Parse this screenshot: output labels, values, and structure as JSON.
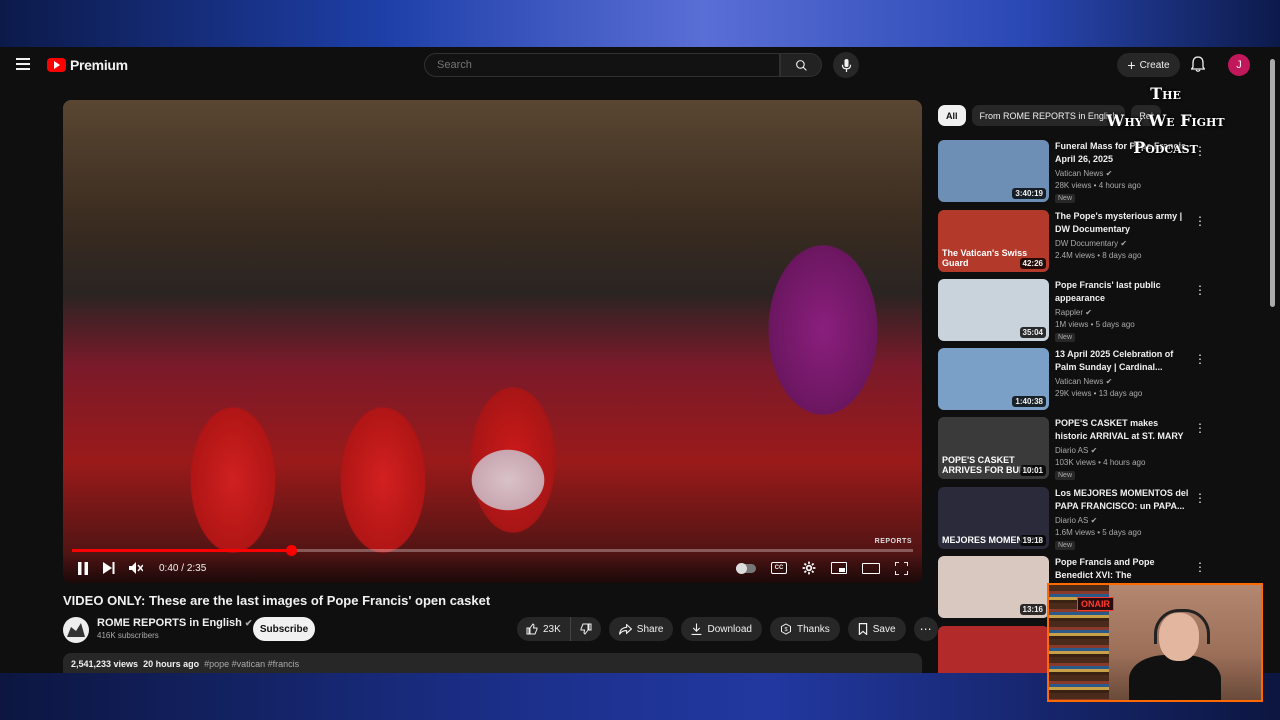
{
  "header": {
    "logo_text": "Premium",
    "search_placeholder": "Search",
    "create_label": "Create",
    "avatar_letter": "J"
  },
  "player": {
    "time_current": "0:40",
    "time_total": "2:35",
    "progress": 0.26,
    "watermark": "REPORTS"
  },
  "video": {
    "title": "VIDEO ONLY: These are the last images of Pope Francis' open casket",
    "channel": "ROME REPORTS in English",
    "subscribers": "416K subscribers",
    "subscribe_label": "Subscribe",
    "likes": "23K",
    "share_label": "Share",
    "download_label": "Download",
    "thanks_label": "Thanks",
    "save_label": "Save",
    "views": "2,541,233 views",
    "posted": "20 hours ago",
    "tags": "#pope #vatican #francis"
  },
  "chips": [
    "All",
    "From ROME REPORTS in English",
    "Rel"
  ],
  "overlay": {
    "podcast_line1": "The",
    "podcast_line2": "Why We Fight",
    "podcast_line3": "Podcast",
    "neon_sign": "ONAIR"
  },
  "recommendations": [
    {
      "title": "Funeral Mass for Pope Francis April 26, 2025",
      "channel": "Vatican News",
      "meta": "28K views • 4 hours ago",
      "badge": "New",
      "duration": "3:40:19",
      "thumb_text": "",
      "thumb_color": "#6d8fb6"
    },
    {
      "title": "The Pope's mysterious army | DW Documentary",
      "channel": "DW Documentary",
      "meta": "2.4M views • 8 days ago",
      "badge": "",
      "duration": "42:26",
      "thumb_text": "The Vatican's Swiss Guard",
      "thumb_color": "#b33a2a"
    },
    {
      "title": "Pope Francis' last public appearance",
      "channel": "Rappler",
      "meta": "1M views • 5 days ago",
      "badge": "New",
      "duration": "35:04",
      "thumb_text": "",
      "thumb_color": "#c9d3dc"
    },
    {
      "title": "13 April 2025 Celebration of Palm Sunday | Cardinal...",
      "channel": "Vatican News",
      "meta": "29K views • 13 days ago",
      "badge": "",
      "duration": "1:40:38",
      "thumb_text": "",
      "thumb_color": "#7aa0c8"
    },
    {
      "title": "POPE'S CASKET makes historic ARRIVAL at ST. MARY MAJOR...",
      "channel": "Diario AS",
      "meta": "103K views • 4 hours ago",
      "badge": "New",
      "duration": "10:01",
      "thumb_text": "POPE'S CASKET ARRIVES FOR BURIAL",
      "thumb_color": "#3a3a3a"
    },
    {
      "title": "Los MEJORES MOMENTOS del PAPA FRANCISCO: un PAPA...",
      "channel": "Diario AS",
      "meta": "1.6M views • 5 days ago",
      "badge": "New",
      "duration": "19:18",
      "thumb_text": "MEJORES MOMENTOS",
      "thumb_color": "#2a2a3a"
    },
    {
      "title": "Pope Francis and Pope Benedict XVI: The Relationshi...",
      "channel": "",
      "meta": "",
      "badge": "",
      "duration": "13:16",
      "thumb_text": "",
      "thumb_color": "#d8c8c0"
    },
    {
      "title": "",
      "channel": "",
      "meta": "",
      "badge": "",
      "duration": "",
      "thumb_text": "",
      "thumb_color": "#b32a2a"
    }
  ]
}
